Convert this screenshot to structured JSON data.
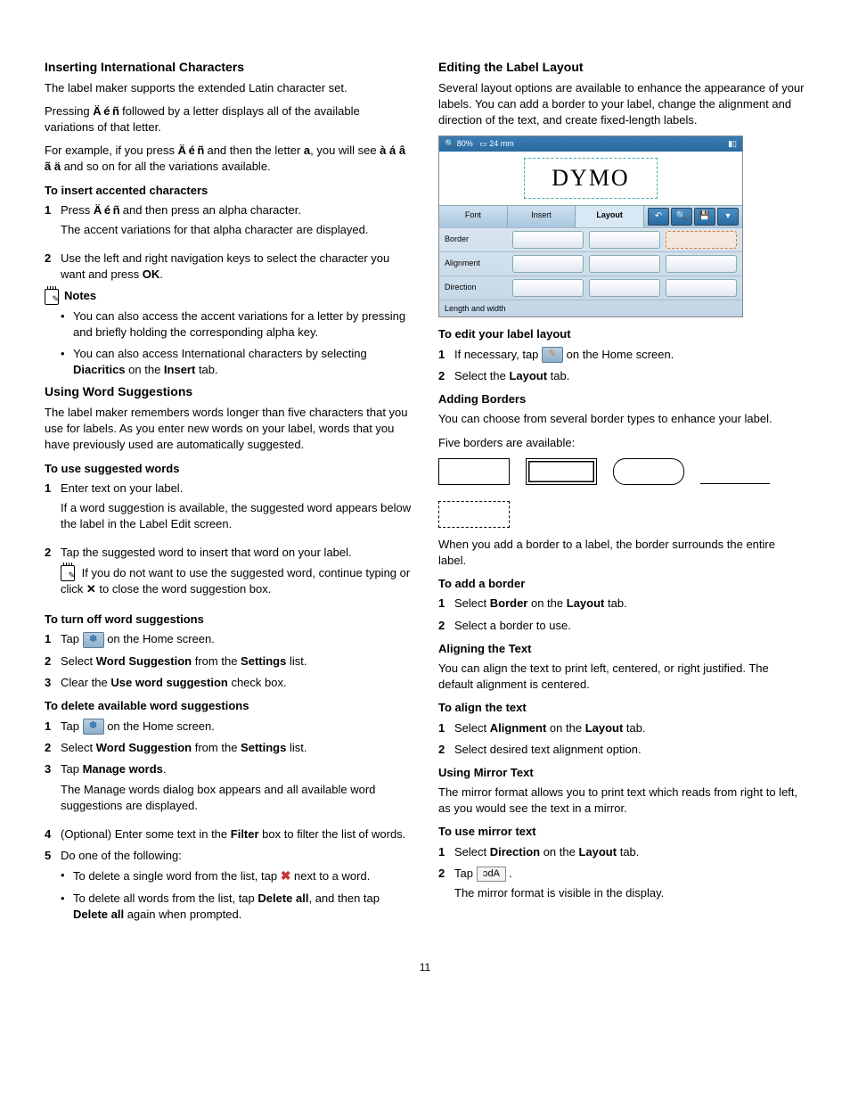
{
  "page_number": "11",
  "left": {
    "h_intl": "Inserting International Characters",
    "p_intl1": "The label maker supports the extended Latin character set.",
    "p_intl2a": "Pressing ",
    "accent_glyph": "Ä é ñ",
    "p_intl2b": " followed by a letter displays all of the available variations of that letter.",
    "p_intl3a": "For example, if you press ",
    "p_intl3b": " and then the letter ",
    "letter_a": "a",
    "p_intl3c": ", you will see ",
    "variations": "à á â ã ä",
    "p_intl3d": " and so on for all the variations available.",
    "h_insert_accent": "To insert accented characters",
    "li1a": "Press ",
    "li1b": " and then press an alpha character.",
    "li1c": "The accent variations for that alpha character are displayed.",
    "li2a": "Use the left and right navigation keys to select the character you want and press ",
    "ok": "OK",
    "notes_label": "Notes",
    "note1": "You can also access the accent variations for a letter by pressing and briefly holding the corresponding alpha key.",
    "note2a": "You can also access International characters by selecting ",
    "diacritics": "Diacritics",
    "note2b": " on the ",
    "insert": "Insert",
    "note2c": " tab.",
    "h_ws": "Using Word Suggestions",
    "p_ws": "The label maker remembers words longer than five characters that you use for labels. As you enter new words on your label, words that you have previously used are automatically suggested.",
    "h_use_sw": "To use suggested words",
    "sw1a": "Enter text on your label.",
    "sw1b": "If a word suggestion is available, the suggested word appears below the label in the Label Edit screen.",
    "sw2a": "Tap the suggested word to insert that word on your label.",
    "sw2b": "If you do not want to use the suggested word, continue typing or click ",
    "x": "✕",
    "sw2c": " to close the word suggestion box.",
    "h_turnoff": "To turn off word suggestions",
    "to1a": "Tap ",
    "to1b": " on the Home screen.",
    "to2a": "Select ",
    "ws_bold": "Word Suggestion",
    "to2b": " from the ",
    "settings": "Settings",
    "to2c": " list.",
    "to3a": "Clear the ",
    "use_ws": "Use word suggestion",
    "to3b": " check box.",
    "h_delete": "To delete available word suggestions",
    "d3a": "Tap ",
    "manage": "Manage words",
    "d3c": "The Manage words dialog box appears and all available word suggestions are displayed.",
    "d4a": "(Optional) Enter some text in the ",
    "filter": "Filter",
    "d4b": " box to filter the list of words.",
    "d5": "Do one of the following:",
    "d5b1a": "To delete a single word from the list, tap ",
    "d5b1b": " next to a word.",
    "d5b2a": "To delete all words from the list, tap ",
    "delete_all": "Delete all",
    "d5b2b": ", and then tap ",
    "d5b2c": " again when prompted."
  },
  "right": {
    "h_edit": "Editing the Label Layout",
    "p_edit": "Several layout options are available to enhance the appearance of your labels. You can add a border to your label, change the alignment and direction of the text, and create fixed-length labels.",
    "app": {
      "zoom": "80%",
      "size": "24 mm",
      "brand": "DYMO",
      "tab_font": "Font",
      "tab_insert": "Insert",
      "tab_layout": "Layout",
      "row_border": "Border",
      "row_align": "Alignment",
      "row_dir": "Direction",
      "row_len": "Length and width"
    },
    "h_toedit": "To edit your label layout",
    "te1a": "If necessary, tap ",
    "te1b": " on the Home screen.",
    "te2a": "Select the ",
    "layout": "Layout",
    "te2b": " tab.",
    "h_borders": "Adding Borders",
    "p_borders": "You can choose from several border types to enhance your label.",
    "p_five": "Five borders are available:",
    "p_when": "When you add a border to a label, the border surrounds the entire label.",
    "h_addborder": "To add a border",
    "ab1a": "Select ",
    "border": "Border",
    "ab1b": " on the ",
    "ab2": "Select a border to use.",
    "h_align": "Aligning the Text",
    "p_align": "You can align the text to print left, centered, or right justified. The default alignment is centered.",
    "h_toalign": "To align the text",
    "al1a": "Select ",
    "alignment": "Alignment",
    "al2": "Select desired text alignment option.",
    "h_mirror": "Using Mirror Text",
    "p_mirror": "The mirror format allows you to print text which reads from right to left, as you would see the text in a mirror.",
    "h_tomirror": "To use mirror text",
    "m1a": "Select ",
    "direction": "Direction",
    "m2a": "Tap ",
    "abc": "Abc",
    "m2c": "The mirror format is visible in the display."
  }
}
